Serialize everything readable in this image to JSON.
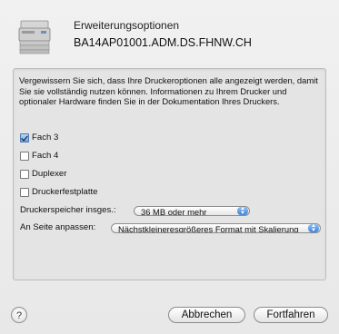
{
  "header": {
    "title": "Erweiterungsoptionen",
    "printer_name": "BA14AP01001.ADM.DS.FHNW.CH",
    "icon": "printer-icon"
  },
  "intro_text": "Vergewissern Sie sich, dass Ihre Druckeroptionen alle angezeigt werden, damit Sie sie vollständig nutzen können. Informationen zu Ihrem Drucker und optionaler Hardware finden Sie in der Dokumentation Ihres Druckers.",
  "options": [
    {
      "label": "Fach 3",
      "checked": true
    },
    {
      "label": "Fach 4",
      "checked": false
    },
    {
      "label": "Duplexer",
      "checked": false
    },
    {
      "label": "Druckerfestplatte",
      "checked": false
    }
  ],
  "memory": {
    "label": "Druckerspeicher insges.:",
    "value": "36 MB oder mehr"
  },
  "fit": {
    "label": "An Seite anpassen:",
    "value": "Nächstkleineresgrößeres Format mit Skalierung"
  },
  "buttons": {
    "help": "?",
    "cancel": "Abbrechen",
    "continue": "Fortfahren"
  }
}
